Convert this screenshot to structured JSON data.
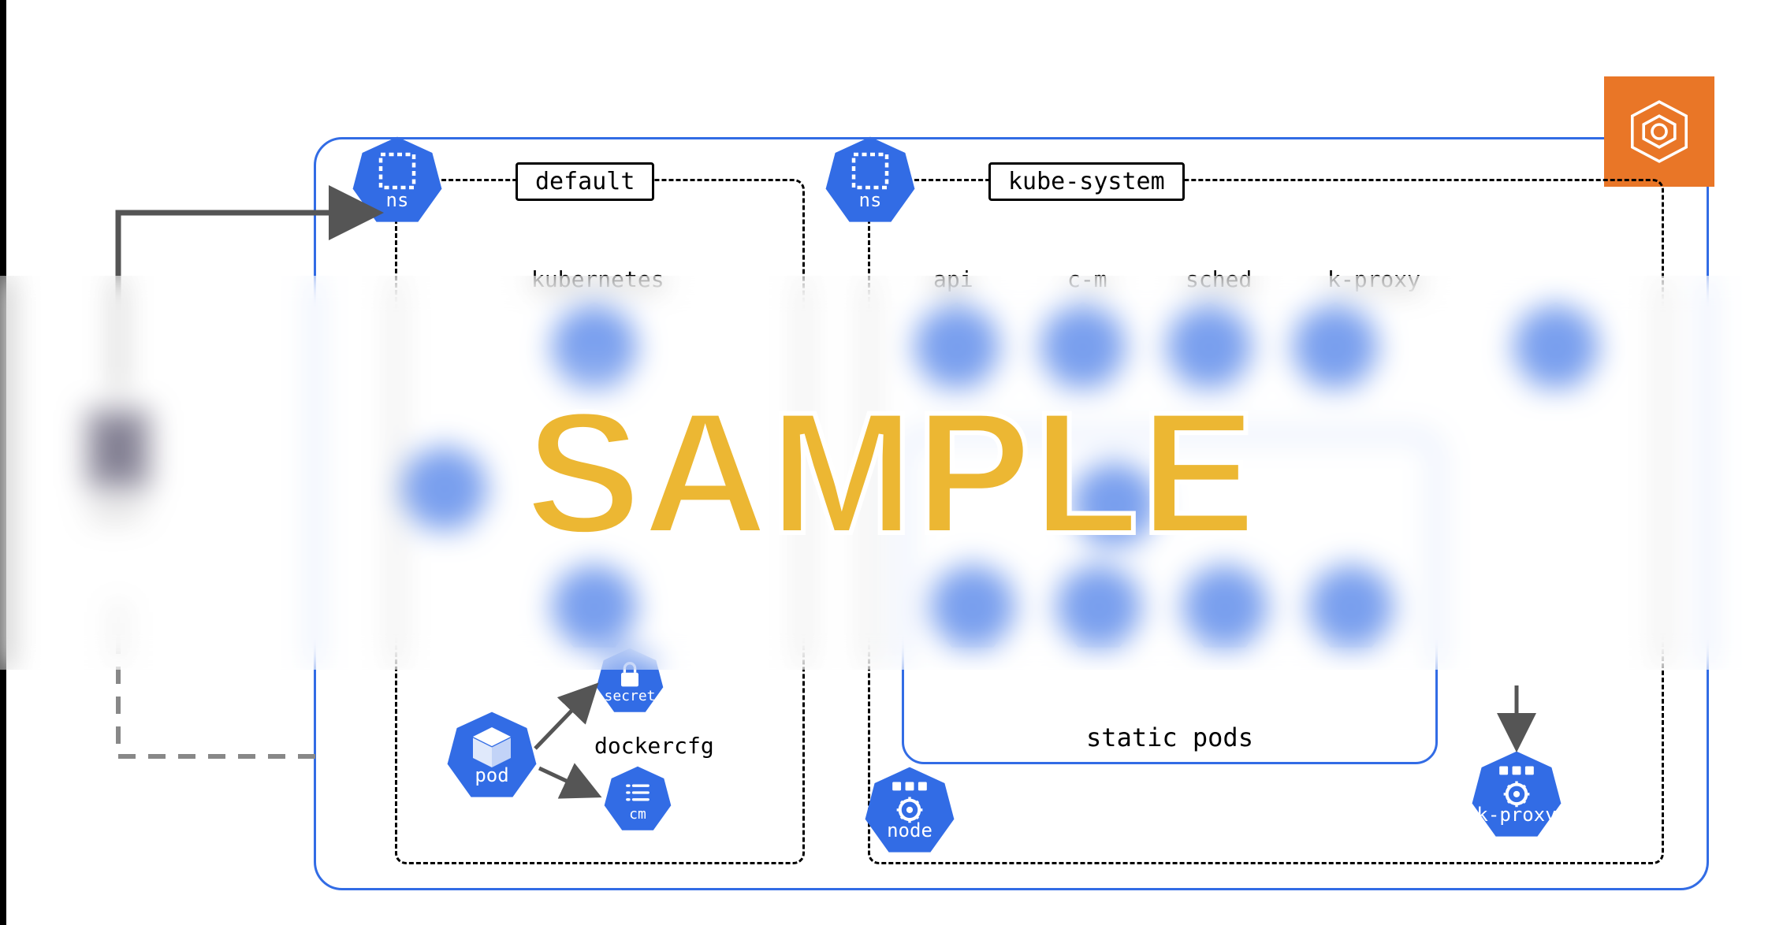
{
  "watermark": "SAMPLE",
  "cluster": {
    "badge": "eks",
    "namespaces": {
      "default": {
        "label": "default",
        "ns_icon": "ns",
        "resources": {
          "kubernetes_svc": {
            "label": "kubernetes",
            "kind": "svc"
          },
          "pod": {
            "kind": "pod"
          },
          "secret": {
            "kind": "secret"
          },
          "cm": {
            "kind": "cm",
            "label": "dockercfg"
          }
        }
      },
      "kube_system": {
        "label": "kube-system",
        "ns_icon": "ns",
        "static_pods_label": "static pods",
        "components": {
          "api": {
            "label": "api"
          },
          "cm": {
            "label": "c-m"
          },
          "sched": {
            "label": "sched"
          },
          "kproxy": {
            "label": "k-proxy"
          }
        },
        "node": {
          "kind": "node"
        },
        "kproxy_ds": {
          "kind": "k-proxy"
        }
      }
    }
  },
  "external": {
    "user_label": "user"
  },
  "colors": {
    "k8s_blue": "#326ce5",
    "eks_orange": "#e97627",
    "sample_yellow": "#ecb733"
  }
}
